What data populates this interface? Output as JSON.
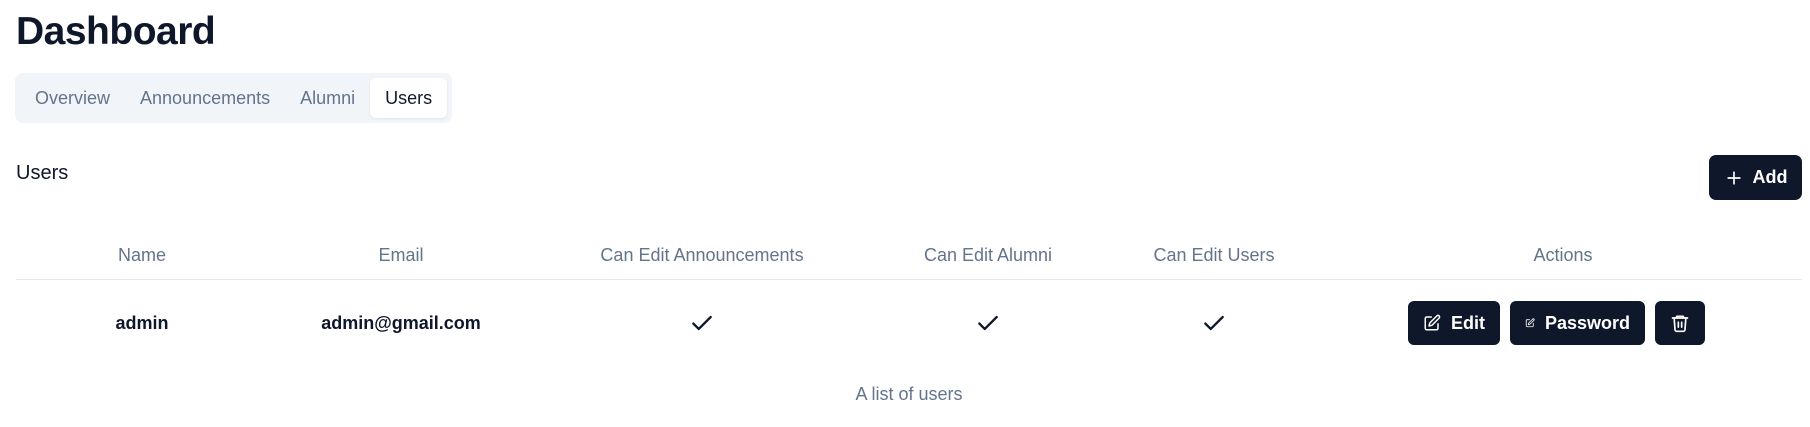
{
  "page": {
    "title": "Dashboard"
  },
  "tabs": [
    {
      "label": "Overview",
      "active": false
    },
    {
      "label": "Announcements",
      "active": false
    },
    {
      "label": "Alumni",
      "active": false
    },
    {
      "label": "Users",
      "active": true
    }
  ],
  "section": {
    "title": "Users",
    "add_label": "Add"
  },
  "table": {
    "headers": {
      "name": "Name",
      "email": "Email",
      "can_edit_announcements": "Can Edit Announcements",
      "can_edit_alumni": "Can Edit Alumni",
      "can_edit_users": "Can Edit Users",
      "actions": "Actions"
    },
    "rows": [
      {
        "name": "admin",
        "email": "admin@gmail.com",
        "can_edit_announcements": true,
        "can_edit_alumni": true,
        "can_edit_users": true
      }
    ],
    "actions": {
      "edit_label": "Edit",
      "password_label": "Password"
    },
    "caption": "A list of users"
  },
  "icons": {
    "add": "plus-icon",
    "edit": "edit-icon",
    "password": "edit-icon",
    "delete": "trash-icon",
    "check": "check-icon"
  },
  "colors": {
    "primary": "#0f172a",
    "muted": "#64748b",
    "tab_bg": "#f1f5f9",
    "border": "#e2e8f0"
  }
}
